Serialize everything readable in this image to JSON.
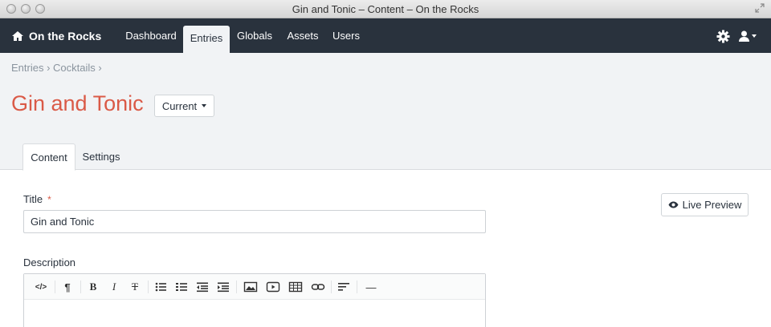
{
  "window": {
    "title": "Gin and Tonic – Content – On the Rocks"
  },
  "nav": {
    "brand": "On the Rocks",
    "items": [
      {
        "label": "Dashboard"
      },
      {
        "label": "Entries"
      },
      {
        "label": "Globals"
      },
      {
        "label": "Assets"
      },
      {
        "label": "Users"
      }
    ],
    "active": "Entries"
  },
  "breadcrumb": {
    "text": "Entries › Cocktails ›"
  },
  "page": {
    "title": "Gin and Tonic",
    "version_label": "Current"
  },
  "tabs": [
    {
      "label": "Content"
    },
    {
      "label": "Settings"
    }
  ],
  "fields": {
    "title": {
      "label": "Title",
      "required_mark": "*",
      "value": "Gin and Tonic"
    },
    "description": {
      "label": "Description"
    }
  },
  "live_preview": {
    "label": "Live Preview"
  },
  "toolbar": {
    "buttons": [
      "html",
      "format",
      "bold",
      "italic",
      "deleted",
      "unorderedlist",
      "orderedlist",
      "outdent",
      "indent",
      "image",
      "video",
      "table",
      "link",
      "alignment",
      "horizontalrule"
    ],
    "glyphs": {
      "html": "</>",
      "format": "¶",
      "bold": "B",
      "italic": "I",
      "deleted": "T",
      "hr": "—"
    }
  },
  "colors": {
    "nav_bg": "#29323d",
    "accent": "#da5a47",
    "header_bg": "#f1f3f5"
  }
}
